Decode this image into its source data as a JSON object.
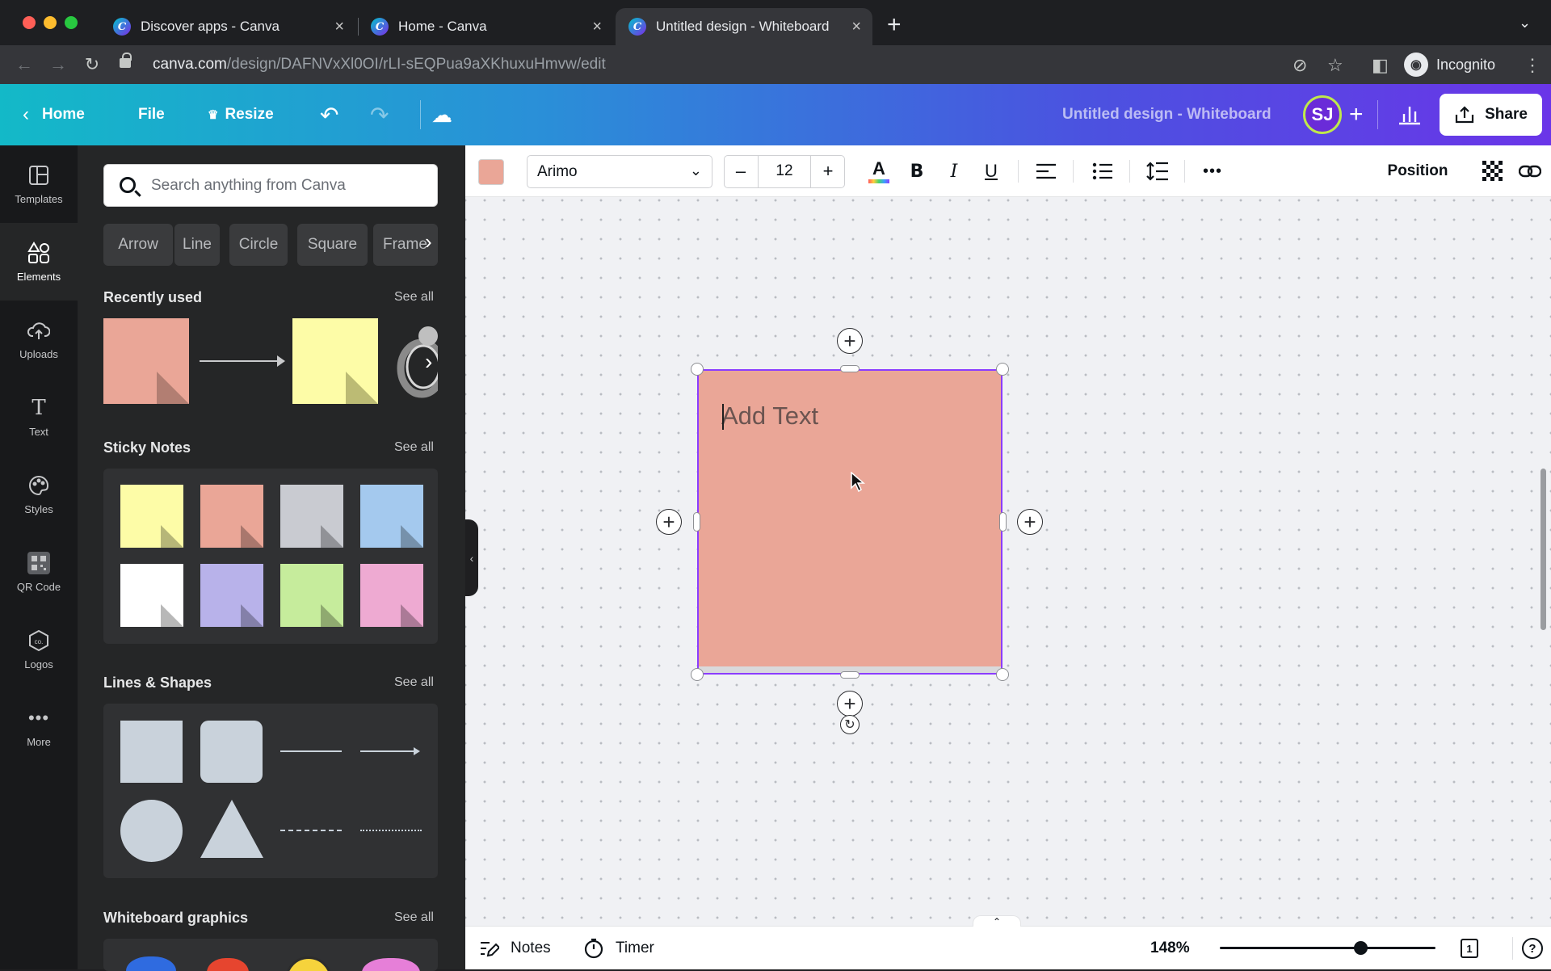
{
  "browser": {
    "tabs": [
      {
        "label": "Discover apps - Canva",
        "active": false
      },
      {
        "label": "Home - Canva",
        "active": false
      },
      {
        "label": "Untitled design - Whiteboard",
        "active": true
      }
    ],
    "url_host": "canva.com",
    "url_path": "/design/DAFNVxXl0OI/rLI-sEQPua9aXKhuxuHmvw/edit",
    "incognito_label": "Incognito"
  },
  "header": {
    "home_label": "Home",
    "file_label": "File",
    "resize_label": "Resize",
    "doc_title": "Untitled design - Whiteboard",
    "avatar_initials": "SJ",
    "share_label": "Share"
  },
  "rail": {
    "items": [
      {
        "label": "Templates",
        "icon": "templates-icon"
      },
      {
        "label": "Elements",
        "icon": "elements-icon"
      },
      {
        "label": "Uploads",
        "icon": "uploads-icon"
      },
      {
        "label": "Text",
        "icon": "text-icon"
      },
      {
        "label": "Styles",
        "icon": "styles-icon"
      },
      {
        "label": "QR Code",
        "icon": "qr-code-icon"
      },
      {
        "label": "Logos",
        "icon": "logos-icon"
      },
      {
        "label": "More",
        "icon": "more-icon"
      }
    ],
    "active": "Elements"
  },
  "panel": {
    "search_placeholder": "Search anything from Canva",
    "chips": [
      "Arrow",
      "Line",
      "Circle",
      "Square",
      "Frame"
    ],
    "sections": {
      "recently_used": "Recently used",
      "sticky_notes": "Sticky Notes",
      "lines_shapes": "Lines & Shapes",
      "whiteboard_graphics": "Whiteboard graphics"
    },
    "see_all": "See all",
    "sticky_colors": [
      "#fdfca7",
      "#eaa697",
      "#c9cbd1",
      "#a4c9ee",
      "#ffffff",
      "#b8b2ea",
      "#c6ec9c",
      "#eeaad2"
    ]
  },
  "toolbar": {
    "fill_color": "#eaa697",
    "font_family": "Arimo",
    "font_size": "12",
    "minus": "–",
    "plus": "+",
    "position_label": "Position"
  },
  "canvas": {
    "sticky_placeholder": "Add Text",
    "sticky_color": "#eaa697",
    "selection_color": "#8b3dff"
  },
  "bottom": {
    "notes_label": "Notes",
    "timer_label": "Timer",
    "zoom": "148%",
    "zoom_fraction": 0.65,
    "page_count": "1",
    "help": "?"
  }
}
